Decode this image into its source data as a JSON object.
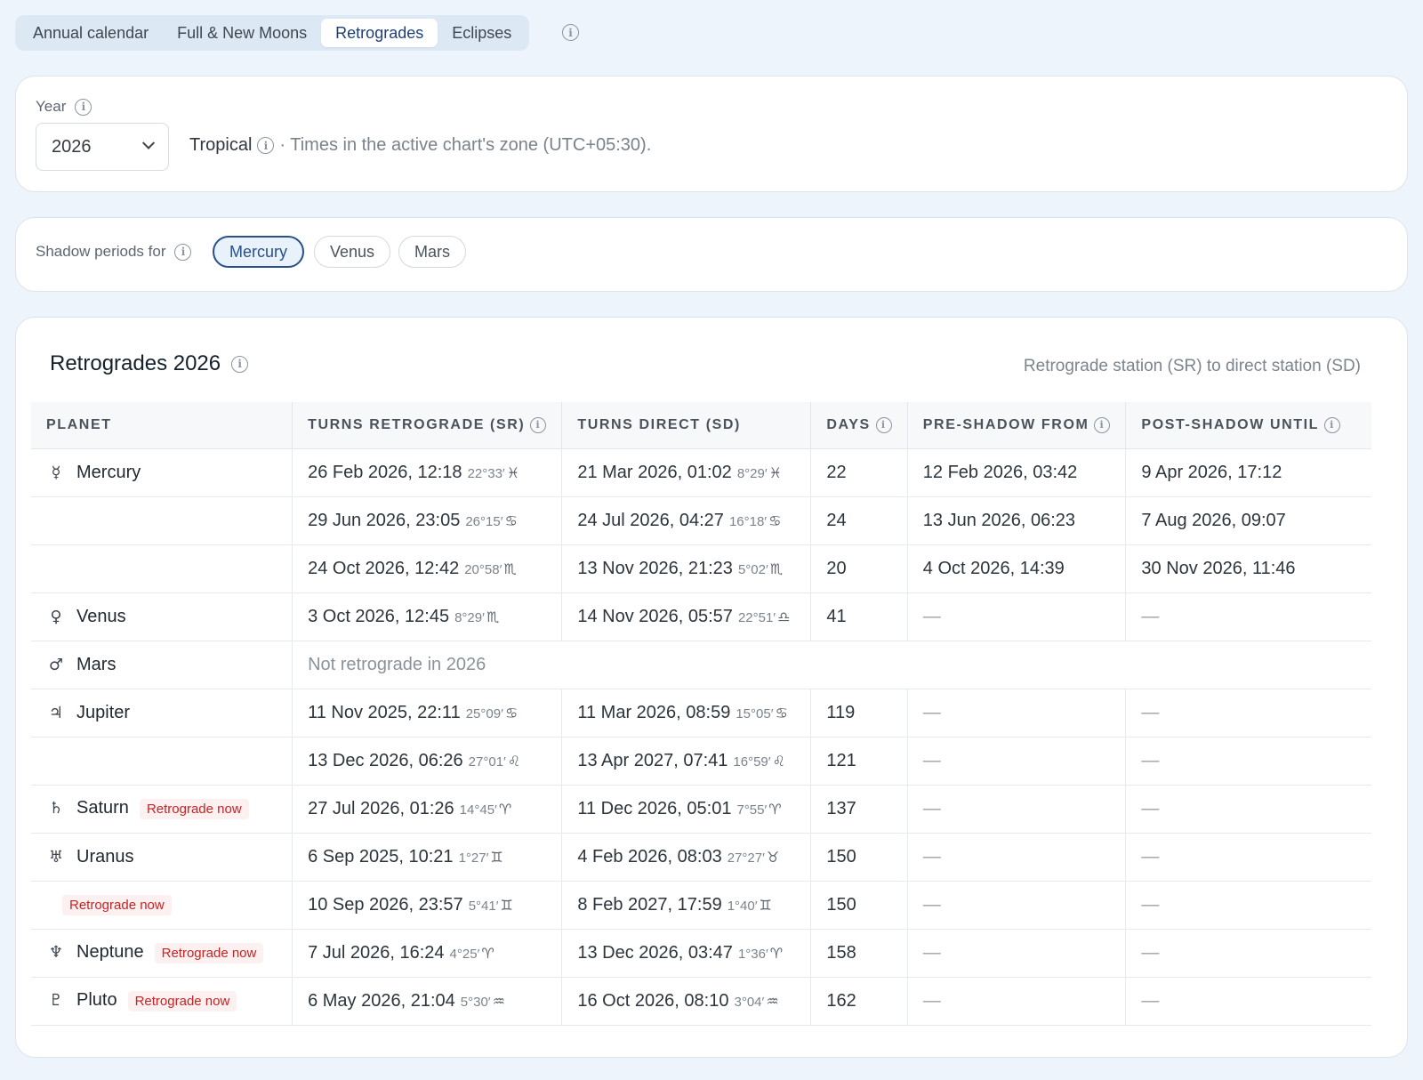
{
  "tabs": [
    {
      "label": "Annual calendar",
      "active": false
    },
    {
      "label": "Full & New Moons",
      "active": false
    },
    {
      "label": "Retrogrades",
      "active": true
    },
    {
      "label": "Eclipses",
      "active": false
    }
  ],
  "info_symbol": "i",
  "year": {
    "label": "Year",
    "value": "2026",
    "zodiac": "Tropical",
    "zone_note": "· Times in the active chart's zone (UTC+05:30)."
  },
  "shadow": {
    "label": "Shadow periods for",
    "options": [
      "Mercury",
      "Venus",
      "Mars"
    ],
    "selected": "Mercury"
  },
  "table": {
    "title": "Retrogrades 2026",
    "subtitle": "Retrograde station (SR) to direct station (SD)",
    "headers": [
      "PLANET",
      "TURNS RETROGRADE (SR)",
      "TURNS DIRECT (SD)",
      "DAYS",
      "PRE-SHADOW FROM",
      "POST-SHADOW UNTIL"
    ],
    "badge_label": "Retrograde now",
    "mars_note": "Not retrograde in 2026",
    "dash": "—",
    "planets": {
      "mercury": {
        "name": "Mercury",
        "glyph": "☿"
      },
      "venus": {
        "name": "Venus",
        "glyph": "♀"
      },
      "mars": {
        "name": "Mars",
        "glyph": "♂"
      },
      "jupiter": {
        "name": "Jupiter",
        "glyph": "♃"
      },
      "saturn": {
        "name": "Saturn",
        "glyph": "♄"
      },
      "uranus": {
        "name": "Uranus",
        "glyph": "♅"
      },
      "neptune": {
        "name": "Neptune",
        "glyph": "♆"
      },
      "pluto": {
        "name": "Pluto",
        "glyph": "♇"
      }
    },
    "rows": [
      {
        "sr": "26 Feb 2026, 12:18",
        "sr_deg": "22°33′",
        "sr_sign": "♓",
        "sd": "21 Mar 2026, 01:02",
        "sd_deg": "8°29′",
        "sd_sign": "♓",
        "days": "22",
        "pre": "12 Feb 2026, 03:42",
        "post": "9 Apr 2026, 17:12"
      },
      {
        "sr": "29 Jun 2026, 23:05",
        "sr_deg": "26°15′",
        "sr_sign": "♋",
        "sd": "24 Jul 2026, 04:27",
        "sd_deg": "16°18′",
        "sd_sign": "♋",
        "days": "24",
        "pre": "13 Jun 2026, 06:23",
        "post": "7 Aug 2026, 09:07"
      },
      {
        "sr": "24 Oct 2026, 12:42",
        "sr_deg": "20°58′",
        "sr_sign": "♏",
        "sd": "13 Nov 2026, 21:23",
        "sd_deg": "5°02′",
        "sd_sign": "♏",
        "days": "20",
        "pre": "4 Oct 2026, 14:39",
        "post": "30 Nov 2026, 11:46"
      },
      {
        "sr": "3 Oct 2026, 12:45",
        "sr_deg": "8°29′",
        "sr_sign": "♏",
        "sd": "14 Nov 2026, 05:57",
        "sd_deg": "22°51′",
        "sd_sign": "♎",
        "days": "41"
      },
      {
        "sr": "11 Nov 2025, 22:11",
        "sr_deg": "25°09′",
        "sr_sign": "♋",
        "sd": "11 Mar 2026, 08:59",
        "sd_deg": "15°05′",
        "sd_sign": "♋",
        "days": "119"
      },
      {
        "sr": "13 Dec 2026, 06:26",
        "sr_deg": "27°01′",
        "sr_sign": "♌",
        "sd": "13 Apr 2027, 07:41",
        "sd_deg": "16°59′",
        "sd_sign": "♌",
        "days": "121"
      },
      {
        "sr": "27 Jul 2026, 01:26",
        "sr_deg": "14°45′",
        "sr_sign": "♈",
        "sd": "11 Dec 2026, 05:01",
        "sd_deg": "7°55′",
        "sd_sign": "♈",
        "days": "137"
      },
      {
        "sr": "6 Sep 2025, 10:21",
        "sr_deg": "1°27′",
        "sr_sign": "♊",
        "sd": "4 Feb 2026, 08:03",
        "sd_deg": "27°27′",
        "sd_sign": "♉",
        "days": "150"
      },
      {
        "sr": "10 Sep 2026, 23:57",
        "sr_deg": "5°41′",
        "sr_sign": "♊",
        "sd": "8 Feb 2027, 17:59",
        "sd_deg": "1°40′",
        "sd_sign": "♊",
        "days": "150"
      },
      {
        "sr": "7 Jul 2026, 16:24",
        "sr_deg": "4°25′",
        "sr_sign": "♈",
        "sd": "13 Dec 2026, 03:47",
        "sd_deg": "1°36′",
        "sd_sign": "♈",
        "days": "158"
      },
      {
        "sr": "6 May 2026, 21:04",
        "sr_deg": "5°30′",
        "sr_sign": "♒",
        "sd": "16 Oct 2026, 08:10",
        "sd_deg": "3°04′",
        "sd_sign": "♒",
        "days": "162"
      }
    ]
  },
  "colors": {
    "accent": "#284f8a",
    "badge_text": "#c42525",
    "badge_bg": "#fdf0f0",
    "page_bg": "#eef4fc"
  }
}
